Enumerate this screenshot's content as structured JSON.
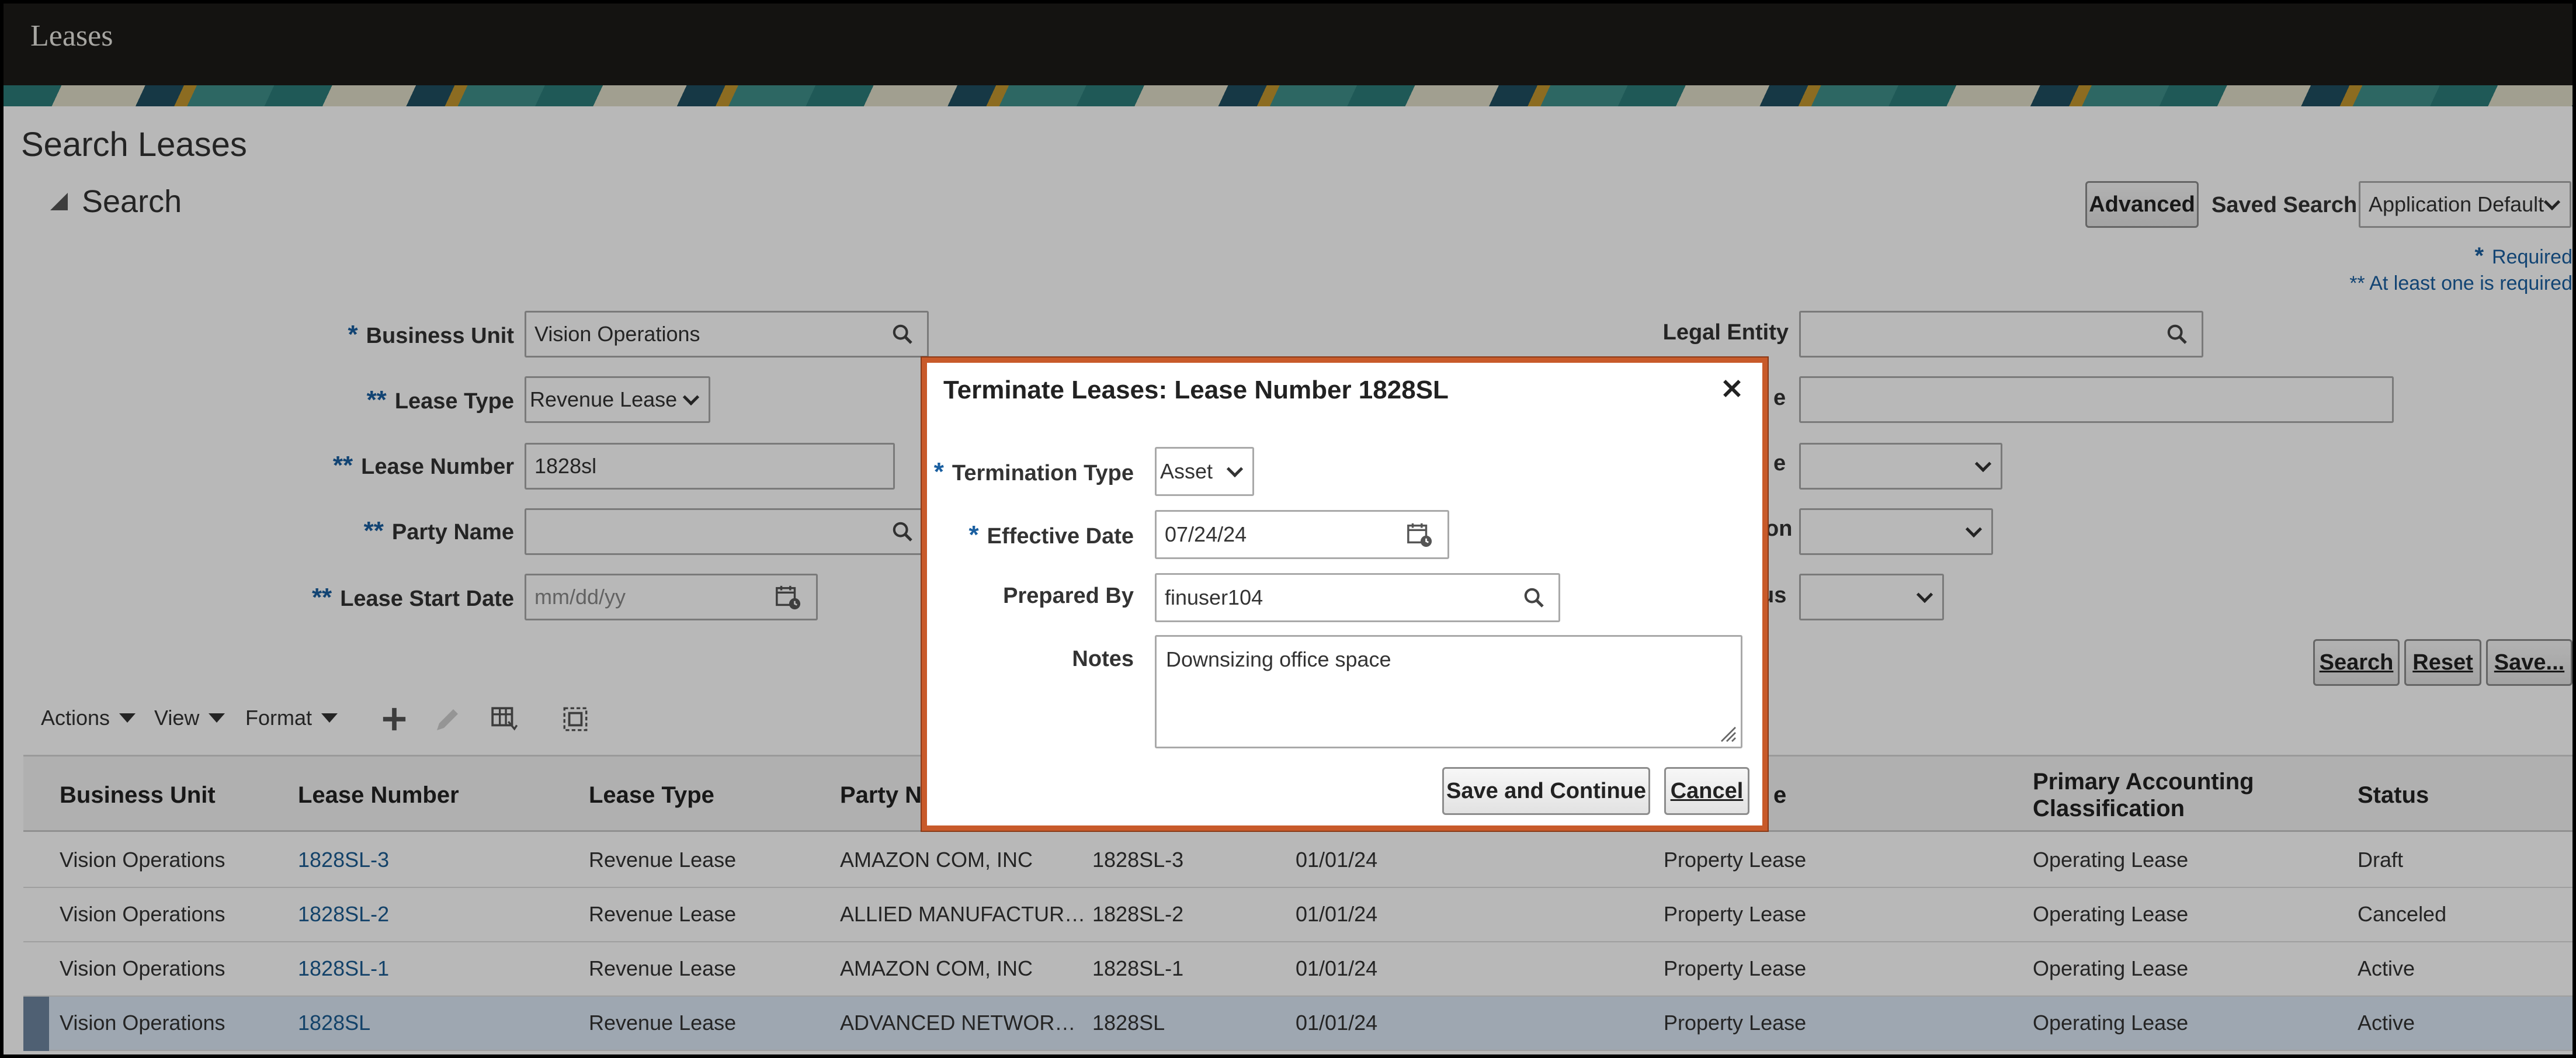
{
  "app": {
    "title": "Leases"
  },
  "page": {
    "title": "Search Leases"
  },
  "search": {
    "header": "Search",
    "advanced_label": "Advanced",
    "saved_search_label": "Saved Search",
    "saved_search_value": "Application Default",
    "required_note": "Required",
    "required_star": "*",
    "at_least_one_note": "** At least one is required",
    "fields": {
      "business_unit": {
        "label": "Business Unit",
        "marker": "*",
        "value": "Vision Operations"
      },
      "lease_type": {
        "label": "Lease Type",
        "marker": "**",
        "value": "Revenue Lease"
      },
      "lease_number": {
        "label": "Lease Number",
        "marker": "**",
        "value": "1828sl"
      },
      "party_name": {
        "label": "Party Name",
        "marker": "**",
        "value": ""
      },
      "lease_start_date": {
        "label": "Lease Start Date",
        "marker": "**",
        "placeholder": "mm/dd/yy"
      },
      "legal_entity": {
        "label": "Legal Entity",
        "value": ""
      },
      "right_label_2_tail": "e",
      "right_label_3_tail": "e",
      "right_label_4_tail": "on",
      "right_label_5_tail": "us"
    },
    "buttons": {
      "search": "Search",
      "reset": "Reset",
      "save": "Save..."
    }
  },
  "toolbar": {
    "actions": "Actions",
    "view": "View",
    "format": "Format"
  },
  "table": {
    "columns": [
      "Business Unit",
      "Lease Number",
      "Lease Type",
      "Party N",
      "e",
      "Primary Accounting Classification",
      "Status"
    ],
    "rows": [
      {
        "business_unit": "Vision Operations",
        "lease_number": "1828SL-3",
        "lease_type": "Revenue Lease",
        "party": "AMAZON COM, INC",
        "lease_no2": "1828SL-3",
        "date": "01/01/24",
        "type2": "Property Lease",
        "classification": "Operating Lease",
        "status": "Draft"
      },
      {
        "business_unit": "Vision Operations",
        "lease_number": "1828SL-2",
        "lease_type": "Revenue Lease",
        "party": "ALLIED MANUFACTUR…",
        "lease_no2": "1828SL-2",
        "date": "01/01/24",
        "type2": "Property Lease",
        "classification": "Operating Lease",
        "status": "Canceled"
      },
      {
        "business_unit": "Vision Operations",
        "lease_number": "1828SL-1",
        "lease_type": "Revenue Lease",
        "party": "AMAZON COM, INC",
        "lease_no2": "1828SL-1",
        "date": "01/01/24",
        "type2": "Property Lease",
        "classification": "Operating Lease",
        "status": "Active"
      },
      {
        "business_unit": "Vision Operations",
        "lease_number": "1828SL",
        "lease_type": "Revenue Lease",
        "party": "ADVANCED NETWOR…",
        "lease_no2": "1828SL",
        "date": "01/01/24",
        "type2": "Property Lease",
        "classification": "Operating Lease",
        "status": "Active"
      }
    ]
  },
  "dialog": {
    "title": "Terminate Leases: Lease Number 1828SL",
    "termination_type": {
      "label": "Termination Type",
      "marker": "*",
      "value": "Asset"
    },
    "effective_date": {
      "label": "Effective Date",
      "marker": "*",
      "value": "07/24/24"
    },
    "prepared_by": {
      "label": "Prepared By",
      "value": "finuser104"
    },
    "notes": {
      "label": "Notes",
      "value": "Downsizing office space"
    },
    "save_continue": "Save and Continue",
    "cancel": "Cancel"
  },
  "colors": {
    "accent_link": "#1b5c92",
    "required_marker": "#1a5fa0",
    "dialog_border": "#c85a2a",
    "header_bg": "#1d1b18"
  }
}
